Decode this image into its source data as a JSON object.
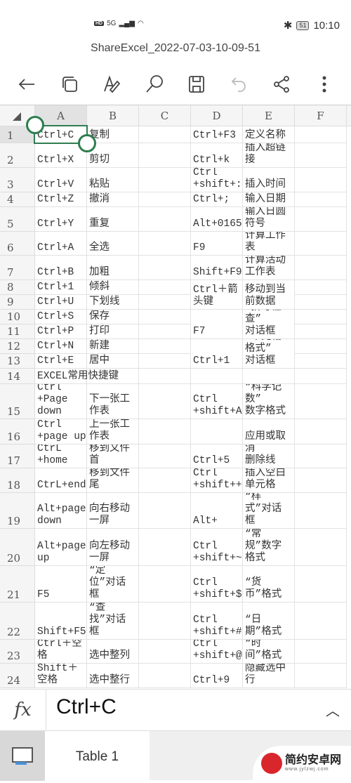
{
  "status_bar": {
    "network": "5G",
    "hd": "HD",
    "battery": "51",
    "time": "10:10"
  },
  "document_title": "ShareExcel_2022-07-03-10-09-51",
  "toolbar": {
    "icons": [
      "back-arrow-icon",
      "copy-icon",
      "edit-icon",
      "search-icon",
      "save-icon",
      "undo-icon",
      "share-icon",
      "more-icon"
    ]
  },
  "sheet": {
    "columns": [
      "A",
      "B",
      "C",
      "D",
      "E",
      "F"
    ],
    "selected_cell": "A1",
    "rows": [
      {
        "num": "1",
        "A": "Ctrl+C",
        "B": "复制",
        "D": "Ctrl+F3",
        "E": "定义名称"
      },
      {
        "num": "2",
        "A": "Ctrl+X",
        "B": "剪切",
        "D": "Ctrl+k",
        "E": "插入超链\n接"
      },
      {
        "num": "3",
        "A": "Ctrl+V",
        "B": "粘贴",
        "D": "Ctrl\n+shift+:",
        "E": "插入时间"
      },
      {
        "num": "4",
        "A": "Ctrl+Z",
        "B": "撤消",
        "D": "Ctrl+;",
        "E": "输入日期"
      },
      {
        "num": "5",
        "A": "Ctrl+Y",
        "B": "重复",
        "D": "Alt+0165",
        "E": "输入日圆\n符号"
      },
      {
        "num": "6",
        "A": "Ctrl+A",
        "B": "全选",
        "D": "F9",
        "E": "计算工作\n表"
      },
      {
        "num": "7",
        "A": "Ctrl+B",
        "B": "加粗",
        "D": "Shift+F9",
        "E": "计算活动\n工作表"
      },
      {
        "num": "8",
        "A": "Ctrl+1",
        "B": "倾斜",
        "D": "Ctrl＋箭\n头键",
        "E": "移动到当\n前数据"
      },
      {
        "num": "9",
        "A": "Ctrl+U",
        "B": "下划线"
      },
      {
        "num": "10",
        "A": "Ctrl+S",
        "B": "保存",
        "D": "F7",
        "E": "“拼写检\n查”\n对话框"
      },
      {
        "num": "11",
        "A": "Ctrl+P",
        "B": "打印"
      },
      {
        "num": "12",
        "A": "Ctrl+N",
        "B": "新建",
        "D": "Ctrl+1",
        "E": "“单元格\n格式”\n对话框"
      },
      {
        "num": "13",
        "A": "Ctrl+E",
        "B": "居中"
      },
      {
        "num": "14",
        "A": "EXCEL常用快捷键"
      },
      {
        "num": "15",
        "A": "Ctrl\n+Page\ndown",
        "B": "下一张工\n作表",
        "D": "Ctrl\n+shift+A",
        "E": "“科学记\n数”\n数字格式"
      },
      {
        "num": "16",
        "A": "Ctrl\n+page up",
        "B": "上一张工\n作表",
        "E": "应用或取"
      },
      {
        "num": "17",
        "A": "CtrL\n+home",
        "B": "移到文件\n首",
        "D": "Ctrl+5",
        "E": "消\n删除线"
      },
      {
        "num": "18",
        "A": "CtrL+end",
        "B": "移到文件\n尾",
        "D": "Ctrl\n+shift++",
        "E": "插入空白\n单元格"
      },
      {
        "num": "19",
        "A": "Alt+page\ndown",
        "B": "向右移动\n一屏",
        "D": "Alt+",
        "E": "“样\n式”对话\n框"
      },
      {
        "num": "20",
        "A": "Alt+page\nup",
        "B": "向左移动\n一屏",
        "D": "Ctrl\n+shift+~",
        "E": "“常\n规”数字\n格式"
      },
      {
        "num": "21",
        "A": "F5",
        "B": "“定\n位”对话\n框",
        "D": "Ctrl\n+shift+$",
        "E": "“货\n币”格式"
      },
      {
        "num": "22",
        "A": "Shift+F5",
        "B": "“查\n找”对话\n框",
        "D": "Ctrl\n+shift+#",
        "E": "“日\n期”格式"
      },
      {
        "num": "23",
        "A": "Ctrl＋空\n格",
        "B": "选中整列",
        "D": "Ctrl\n+shift+@",
        "E": "“时\n间”格式"
      },
      {
        "num": "24",
        "A": "Shift＋\n空格",
        "B": "选中整行",
        "D": "Ctrl+9",
        "E": "隐藏选中\n行"
      }
    ]
  },
  "formula_bar": {
    "fx_label": "fx",
    "value": "Ctrl+C"
  },
  "sheet_tabs": [
    {
      "label": "Table 1",
      "active": true
    }
  ],
  "watermark": {
    "text": "简约安卓网",
    "url": "www.jylzwj.com"
  },
  "colors": {
    "selection": "#2e7d4f",
    "header_bg": "#f5f5f5"
  }
}
